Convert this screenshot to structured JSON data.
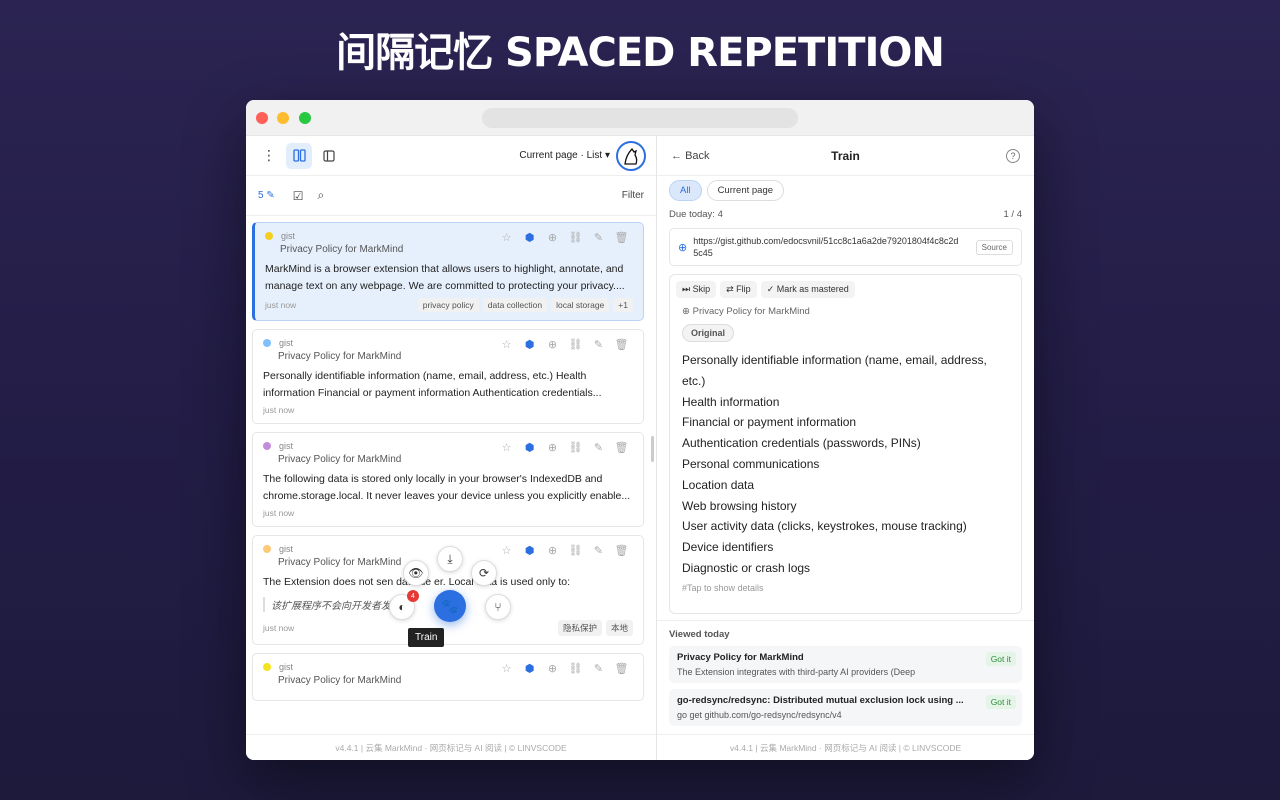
{
  "hero": {
    "title": "间隔记忆 SPACED REPETITION"
  },
  "left": {
    "view_label": "Current page · List",
    "count": "5",
    "filter_label": "Filter",
    "cards": [
      {
        "source": "gist",
        "page_title": "Privacy Policy for MarkMind",
        "dot_color": "#f5cf1f",
        "body": "MarkMind is a browser extension that allows users to highlight, annotate, and manage text on any webpage. We are committed to protecting your privacy....",
        "time": "just now",
        "tags": [
          "privacy policy",
          "data collection",
          "local storage",
          "+1"
        ]
      },
      {
        "source": "gist",
        "page_title": "Privacy Policy for MarkMind",
        "dot_color": "#7fbfff",
        "body": "Personally identifiable information (name, email, address, etc.) Health information Financial or payment information Authentication credentials...",
        "time": "just now",
        "tags": []
      },
      {
        "source": "gist",
        "page_title": "Privacy Policy for MarkMind",
        "dot_color": "#c48ddb",
        "body": "The following data is stored only locally in your browser's IndexedDB and chrome.storage.local. It never leaves your device unless you explicitly enable...",
        "time": "just now",
        "tags": []
      },
      {
        "source": "gist",
        "page_title": "Privacy Policy for MarkMind",
        "dot_color": "#ffc876",
        "body": "The Extension does not sen       data       de       er. Local data is used only to:",
        "note": "该扩展程序不会向开发者发送任",
        "time": "just now",
        "tags": [
          "隐私保护",
          "本地"
        ]
      },
      {
        "source": "gist",
        "page_title": "Privacy Policy for MarkMind",
        "dot_color": "#f5e31f",
        "body": "",
        "time": "",
        "tags": []
      }
    ],
    "fab": {
      "badge": "4",
      "tooltip": "Train"
    },
    "footer": "v4.4.1  |  云集 MarkMind · 网页标记与 AI 阅读  |  © LINVSCODE"
  },
  "right": {
    "back_label": "Back",
    "title": "Train",
    "help": "?",
    "pills": [
      "All",
      "Current page"
    ],
    "due_label": "Due today: 4",
    "page_indicator": "1 / 4",
    "url": "https://gist.github.com/edocsvnil/51cc8c1a6a2de79201804f4c8c2d5c45",
    "source_label": "Source",
    "actions": [
      "Skip",
      "Flip",
      "Mark as mastered"
    ],
    "card_source": "Privacy Policy for MarkMind",
    "origin_label": "Original",
    "lines": [
      "Personally identifiable information (name, email, address, etc.)",
      "Health information",
      "Financial or payment information",
      "Authentication credentials (passwords, PINs)",
      "Personal communications",
      "Location data",
      "Web browsing history",
      "User activity data (clicks, keystrokes, mouse tracking)",
      "Device identifiers",
      "Diagnostic or crash logs"
    ],
    "hint": "#Tap to show details",
    "viewed_heading": "Viewed today",
    "viewed": [
      {
        "title": "Privacy Policy for MarkMind",
        "snippet": "The Extension integrates with third-party AI providers (Deep",
        "status": "Got it"
      },
      {
        "title": "go-redsync/redsync: Distributed mutual exclusion lock using ...",
        "snippet": "go get github.com/go-redsync/redsync/v4",
        "status": "Got it"
      }
    ],
    "footer": "v4.4.1  |  云集 MarkMind · 网页标记与 AI 阅读  |  © LINVSCODE"
  },
  "colors": {
    "accent": "#2b6fe0",
    "background": "#262050"
  }
}
